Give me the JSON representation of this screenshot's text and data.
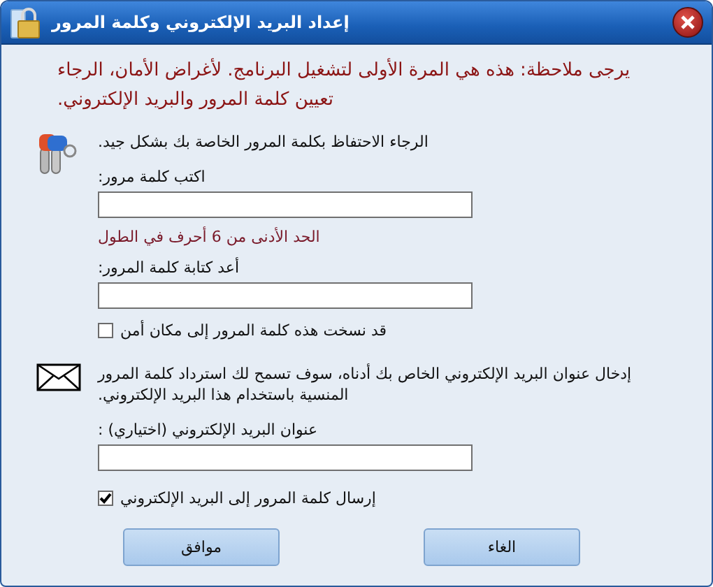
{
  "window": {
    "title": "إعداد البريد الإلكتروني وكلمة المرور"
  },
  "note": "يرجى ملاحظة: هذه هي المرة الأولى لتشغيل البرنامج. لأغراض الأمان، الرجاء تعيين كلمة المرور والبريد الإلكتروني.",
  "password_section": {
    "info": "الرجاء الاحتفاظ بكلمة المرور الخاصة بك بشكل جيد.",
    "password_label": "اكتب كلمة مرور:",
    "hint": "الحد الأدنى من 6 أحرف في الطول",
    "confirm_label": "أعد كتابة كلمة المرور:",
    "checkbox": {
      "label": "قد نسخت هذه كلمة المرور إلى مكان أمن",
      "checked": false
    }
  },
  "email_section": {
    "info": "إدخال عنوان البريد الإلكتروني الخاص بك أدناه، سوف تسمح لك استرداد كلمة المرور المنسية باستخدام هذا البريد الإلكتروني.",
    "email_label": "عنوان البريد الإلكتروني (اختياري) :",
    "checkbox": {
      "label": "إرسال كلمة المرور إلى البريد الإلكتروني",
      "checked": true
    }
  },
  "buttons": [
    "الغاء",
    "موافق"
  ]
}
